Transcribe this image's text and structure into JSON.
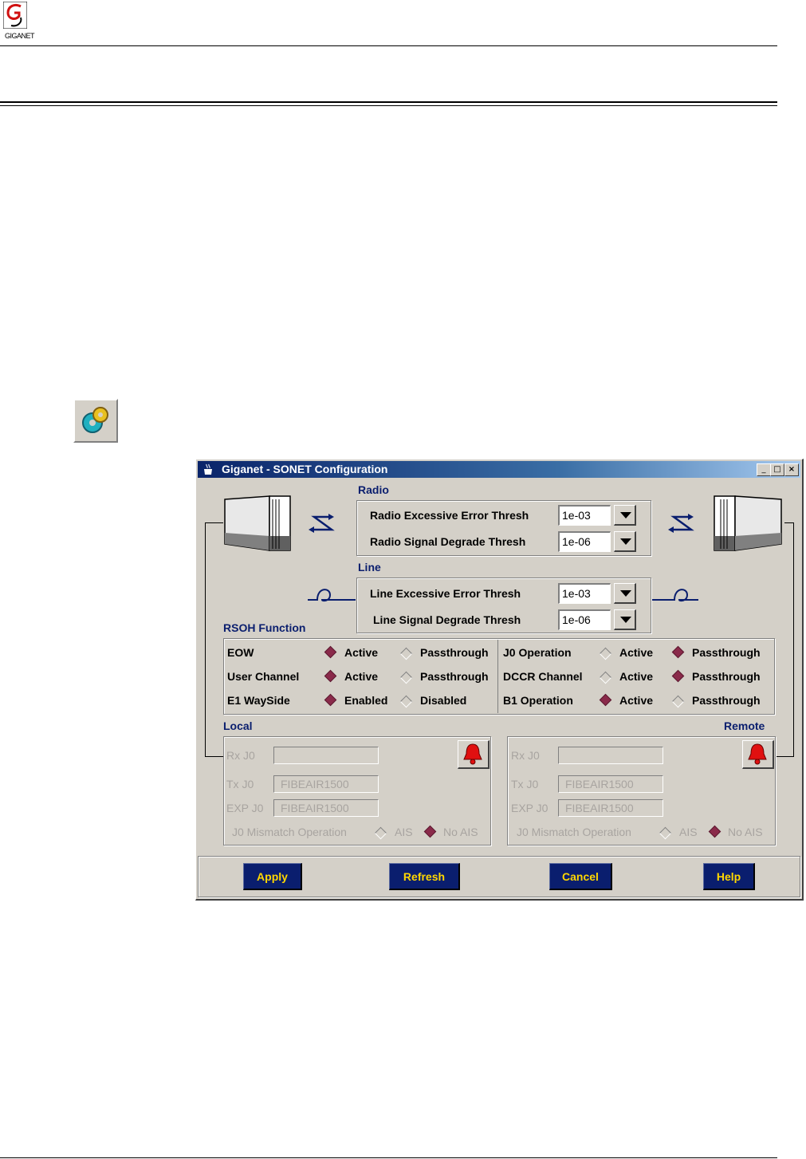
{
  "header": {
    "logo_text": "GIGANET"
  },
  "window": {
    "title": "Giganet - SONET Configuration",
    "minimize_label": "_",
    "maximize_label": "□",
    "close_label": "×"
  },
  "radio_section": {
    "title": "Radio",
    "excessive_label": "Radio Excessive Error Thresh",
    "excessive_value": "1e-03",
    "degrade_label": "Radio Signal Degrade Thresh",
    "degrade_value": "1e-06"
  },
  "line_section": {
    "title": "Line",
    "excessive_label": "Line Excessive Error Thresh",
    "excessive_value": "1e-03",
    "degrade_label": "Line Signal Degrade Thresh",
    "degrade_value": "1e-06"
  },
  "rsoh": {
    "title": "RSOH Function",
    "rows_left": [
      {
        "label": "EOW",
        "opt1": "Active",
        "opt2": "Passthrough",
        "selected": 1
      },
      {
        "label": "User Channel",
        "opt1": "Active",
        "opt2": "Passthrough",
        "selected": 1
      },
      {
        "label": "E1 WaySide",
        "opt1": "Enabled",
        "opt2": "Disabled",
        "selected": 1
      }
    ],
    "rows_right": [
      {
        "label": "J0 Operation",
        "opt1": "Active",
        "opt2": "Passthrough",
        "selected": 2
      },
      {
        "label": "DCCR Channel",
        "opt1": "Active",
        "opt2": "Passthrough",
        "selected": 2
      },
      {
        "label": "B1 Operation",
        "opt1": "Active",
        "opt2": "Passthrough",
        "selected": 1
      }
    ]
  },
  "local": {
    "title": "Local",
    "rx_label": "Rx J0",
    "rx_value": "",
    "tx_label": "Tx J0",
    "tx_value": "FIBEAIR1500",
    "exp_label": "EXP J0",
    "exp_value": "FIBEAIR1500",
    "mismatch_label": "J0 Mismatch Operation",
    "opt1": "AIS",
    "opt2": "No AIS"
  },
  "remote": {
    "title": "Remote",
    "rx_label": "Rx J0",
    "rx_value": "",
    "tx_label": "Tx J0",
    "tx_value": "FIBEAIR1500",
    "exp_label": "EXP J0",
    "exp_value": "FIBEAIR1500",
    "mismatch_label": "J0 Mismatch Operation",
    "opt1": "AIS",
    "opt2": "No AIS"
  },
  "buttons": {
    "apply": "Apply",
    "refresh": "Refresh",
    "cancel": "Cancel",
    "help": "Help"
  },
  "colors": {
    "accent": "#0a1e6e",
    "button_text": "#ffd700",
    "selected_radio": "#8a2a4a",
    "alarm": "#e01010"
  }
}
